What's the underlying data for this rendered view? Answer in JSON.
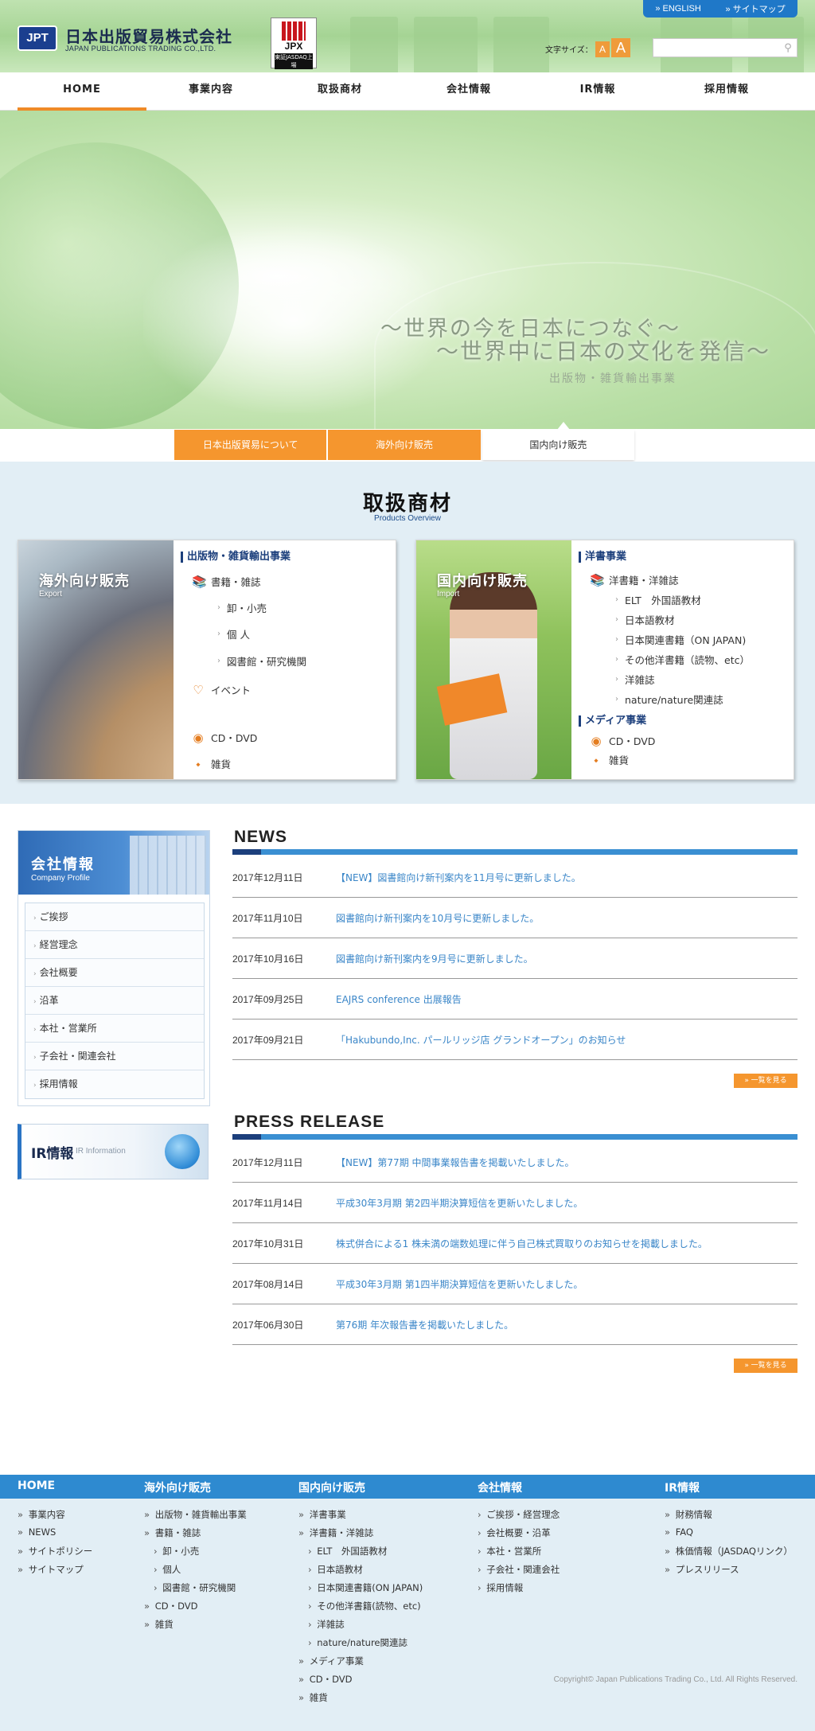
{
  "header": {
    "logo_mark": "JPT",
    "logo_jp": "日本出版貿易株式会社",
    "logo_en": "JAPAN PUBLICATIONS TRADING CO.,LTD.",
    "jpx_title": "JPX",
    "jpx_sub": "東証JASDAQ上場",
    "toplinks": [
      "» ENGLISH",
      "» サイトマップ"
    ],
    "fontsize_label": "文字サイズ：",
    "fontsize_small": "A",
    "fontsize_large": "A",
    "search_placeholder": ""
  },
  "nav": [
    {
      "label": "HOME",
      "active": true
    },
    {
      "label": "事業内容"
    },
    {
      "label": "取扱商材"
    },
    {
      "label": "会社情報"
    },
    {
      "label": "IR情報"
    },
    {
      "label": "採用情報"
    }
  ],
  "hero": {
    "line1": "～世界の今を日本につなぐ～",
    "line2": "～世界中に日本の文化を発信～",
    "line3": "出版物・雑貨輸出事業"
  },
  "tabs": [
    "日本出版貿易について",
    "海外向け販売",
    "国内向け販売"
  ],
  "products": {
    "title": "取扱商材",
    "subtitle": "Products Overview",
    "export": {
      "title": "海外向け販売",
      "sub": "Export",
      "section": "出版物・雑貨輸出事業",
      "books": "書籍・雑誌",
      "sub_items": [
        "卸・小売",
        "個 人",
        "図書館・研究機関"
      ],
      "event": "イベント",
      "cd": "CD・DVD",
      "goods": "雑貨"
    },
    "import": {
      "title": "国内向け販売",
      "sub": "Import",
      "section1": "洋書事業",
      "books": "洋書籍・洋雑誌",
      "sub_items": [
        "ELT　外国語教材",
        "日本語教材",
        "日本関連書籍（ON JAPAN)",
        "その他洋書籍（読物、etc）",
        "洋雑誌",
        "nature/nature関連誌"
      ],
      "section2": "メディア事業",
      "cd": "CD・DVD",
      "goods": "雑貨"
    }
  },
  "sidebar": {
    "company_title": "会社情報",
    "company_sub": "Company Profile",
    "menu": [
      "ご挨拶",
      "経営理念",
      "会社概要",
      "沿革",
      "本社・営業所",
      "子会社・関連会社",
      "採用情報"
    ],
    "ir_title": "IR情報",
    "ir_sub": "IR Information"
  },
  "news": {
    "title": "NEWS",
    "items": [
      {
        "date": "2017年12月11日",
        "text": "【NEW】図書館向け新刊案内を11月号に更新しました。"
      },
      {
        "date": "2017年11月10日",
        "text": "図書館向け新刊案内を10月号に更新しました。"
      },
      {
        "date": "2017年10月16日",
        "text": "図書館向け新刊案内を9月号に更新しました。"
      },
      {
        "date": "2017年09月25日",
        "text": "EAJRS conference 出展報告"
      },
      {
        "date": "2017年09月21日",
        "text": "「Hakubundo,Inc. パールリッジ店 グランドオープン」のお知らせ"
      }
    ],
    "more": "» 一覧を見る"
  },
  "press": {
    "title": "PRESS RELEASE",
    "items": [
      {
        "date": "2017年12月11日",
        "text": "【NEW】第77期 中間事業報告書を掲載いたしました。"
      },
      {
        "date": "2017年11月14日",
        "text": "平成30年3月期 第2四半期決算短信を更新いたしました。"
      },
      {
        "date": "2017年10月31日",
        "text": "株式併合による1 株未満の端数処理に伴う自己株式買取りのお知らせを掲載しました。"
      },
      {
        "date": "2017年08月14日",
        "text": "平成30年3月期 第1四半期決算短信を更新いたしました。"
      },
      {
        "date": "2017年06月30日",
        "text": "第76期 年次報告書を掲載いたしました。"
      }
    ],
    "more": "» 一覧を見る"
  },
  "footer": {
    "cols": [
      {
        "head": "HOME",
        "items": [
          [
            "» ",
            "事業内容"
          ],
          [
            "» ",
            "NEWS"
          ],
          [
            "» ",
            "サイトポリシー"
          ],
          [
            "» ",
            "サイトマップ"
          ]
        ]
      },
      {
        "head": "海外向け販売",
        "items": [
          [
            "» ",
            "出版物・雑貨輸出事業"
          ],
          [
            "» ",
            "書籍・雑誌"
          ],
          [
            "› ",
            "卸・小売"
          ],
          [
            "› ",
            "個人"
          ],
          [
            "› ",
            "図書館・研究機関"
          ],
          [
            "» ",
            "CD・DVD"
          ],
          [
            "» ",
            "雑貨"
          ]
        ]
      },
      {
        "head": "国内向け販売",
        "items": [
          [
            "» ",
            "洋書事業"
          ],
          [
            "» ",
            "洋書籍・洋雑誌"
          ],
          [
            "› ",
            "ELT　外国語教材"
          ],
          [
            "› ",
            "日本語教材"
          ],
          [
            "› ",
            "日本関連書籍(ON JAPAN)"
          ],
          [
            "› ",
            "その他洋書籍(読物、etc)"
          ],
          [
            "› ",
            "洋雑誌"
          ],
          [
            "› ",
            "nature/nature関連誌"
          ],
          [
            "» ",
            "メディア事業"
          ],
          [
            "» ",
            "CD・DVD"
          ],
          [
            "» ",
            "雑貨"
          ]
        ]
      },
      {
        "head": "会社情報",
        "items": [
          [
            "› ",
            "ご挨拶・経営理念"
          ],
          [
            "› ",
            "会社概要・沿革"
          ],
          [
            "› ",
            "本社・営業所"
          ],
          [
            "› ",
            "子会社・関連会社"
          ],
          [
            "› ",
            "採用情報"
          ]
        ]
      },
      {
        "head": "IR情報",
        "items": [
          [
            "» ",
            "財務情報"
          ],
          [
            "» ",
            "FAQ"
          ],
          [
            "» ",
            "株価情報（JASDAQリンク）"
          ],
          [
            "» ",
            "プレスリリース"
          ]
        ]
      }
    ],
    "copyright": "Copyright© Japan Publications Trading Co., Ltd. All Rights Reserved."
  }
}
